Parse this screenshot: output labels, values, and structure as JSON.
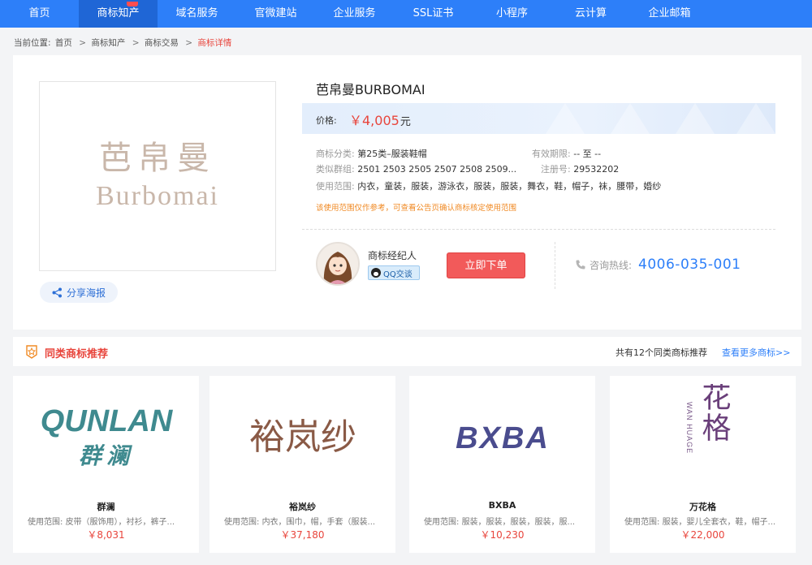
{
  "nav": {
    "items": [
      "首页",
      "商标知产",
      "域名服务",
      "官微建站",
      "企业服务",
      "SSL证书",
      "小程序",
      "云计算",
      "企业邮箱"
    ],
    "active_index": 1
  },
  "breadcrumb": {
    "prefix": "当前位置:",
    "items": [
      "首页",
      "商标知产",
      "商标交易"
    ],
    "current": "商标详情",
    "separator": ">"
  },
  "trademark": {
    "logo_cn": "芭帛曼",
    "logo_en": "Burbomai",
    "title": "芭帛曼BURBOMAI",
    "price_label": "价格:",
    "price": "￥4,005",
    "price_unit": "元",
    "category_label": "商标分类:",
    "category": "第25类–服装鞋帽",
    "validity_label": "有效期限:",
    "validity": "-- 至 --",
    "group_label": "类似群组:",
    "group": "2501 2503 2505 2507 2508 2509...",
    "reg_label": "注册号:",
    "reg_no": "29532202",
    "scope_label": "使用范围:",
    "scope": "内衣，童装，服装，游泳衣，服装，服装，舞衣，鞋，帽子，袜，腰带，婚纱",
    "notice": "该使用范围仅作参考，可查看公告页确认商标核定使用范围"
  },
  "share_label": "分享海报",
  "agent": {
    "label": "商标经纪人",
    "qq_label": "QQ交谈"
  },
  "order_button": "立即下单",
  "hotline": {
    "label": "咨询热线:",
    "number": "4006-035-001"
  },
  "recommend": {
    "title": "同类商标推荐",
    "count_text": "共有12个同类商标推荐",
    "more_link": "查看更多商标>>",
    "scope_prefix": "使用范围:",
    "cards": [
      {
        "logo_en": "QUNLAN",
        "logo_cn": "群澜",
        "name": "群澜",
        "scope": "皮带（服饰用），衬衫，裤子...",
        "price": "￥8,031"
      },
      {
        "logo_cn": "裕岚纱",
        "name": "裕岚纱",
        "scope": "内衣，围巾，帽，手套（服装...",
        "price": "￥37,180"
      },
      {
        "logo_en": "BXBA",
        "name": "BXBA",
        "scope": "服装，服装，服装，服装，服...",
        "price": "￥10,230"
      },
      {
        "logo_cn": "万花格",
        "logo_en_vertical": "WAN HUAGE",
        "name": "万花格",
        "scope": "服装，婴儿全套衣，鞋，帽子...",
        "price": "￥22,000"
      }
    ]
  },
  "colors": {
    "nav_bg": "#2d7ff9",
    "accent_red": "#e8453c",
    "order_button": "#f25a5a",
    "link_blue": "#2d7ff9",
    "notice_orange": "#f08a24"
  }
}
